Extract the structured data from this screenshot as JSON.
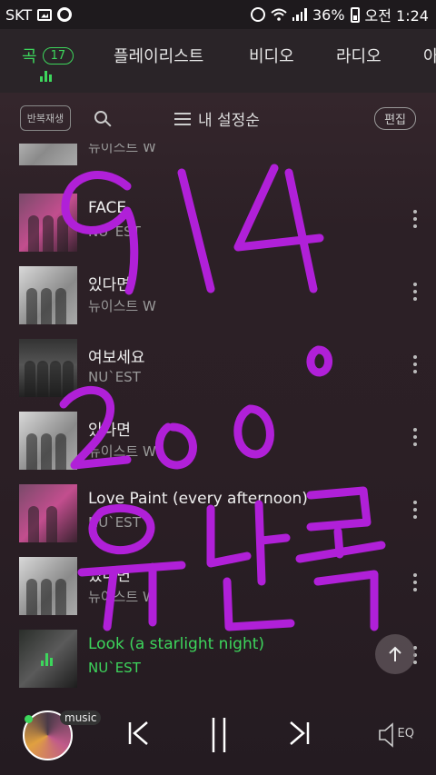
{
  "status_bar": {
    "carrier": "SKT",
    "battery": "36%",
    "time": "오전 1:24"
  },
  "tabs": [
    {
      "label": "곡",
      "count": "17"
    },
    {
      "label": "플레이리스트"
    },
    {
      "label": "비디오"
    },
    {
      "label": "라디오"
    },
    {
      "label": "아"
    }
  ],
  "toolbar": {
    "repeat_label": "반복재생",
    "sort_label": "내 설정순",
    "edit_label": "편집"
  },
  "songs": [
    {
      "title": "",
      "artist": "뉴이스트 W"
    },
    {
      "title": "FACE",
      "artist": "NU`EST"
    },
    {
      "title": "있다면",
      "artist": "뉴이스트 W"
    },
    {
      "title": "여보세요",
      "artist": "NU`EST"
    },
    {
      "title": "있다면",
      "artist": "뉴이스트 W"
    },
    {
      "title": "Love Paint (every afternoon)",
      "artist": "NU`EST"
    },
    {
      "title": "있다면",
      "artist": "뉴이스트 W"
    },
    {
      "title": "Look (a starlight night)",
      "artist": "NU`EST",
      "playing": true
    }
  ],
  "player": {
    "badge": "music",
    "eq_label": "EQ"
  },
  "colors": {
    "accent": "#3dd65c",
    "scribble": "#b020d8"
  },
  "handwriting": {
    "lines": [
      "914",
      "200",
      "유난독"
    ]
  }
}
